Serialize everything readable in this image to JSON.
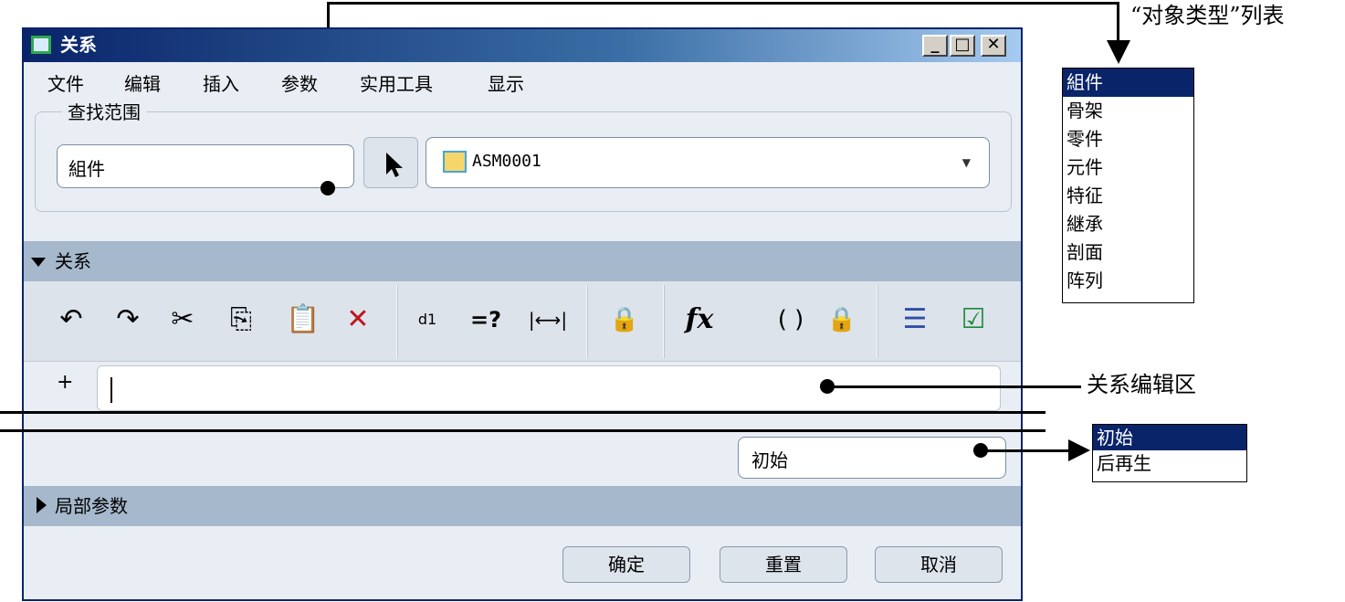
{
  "dialog": {
    "title": "关系",
    "window_buttons": {
      "minimize": "_",
      "maximize": "□",
      "close": "✕"
    }
  },
  "menu": [
    "文件",
    "编辑",
    "插入",
    "参数",
    "实用工具",
    "显示"
  ],
  "search": {
    "legend": "查找范围",
    "object_type": "組件",
    "model": "ASM0001"
  },
  "relations": {
    "header": "关系",
    "editor_plus": "+"
  },
  "toolbar": {
    "undo": "↶",
    "redo": "↷",
    "cut": "✂",
    "copy": "⎘",
    "paste": "📋",
    "delete": "✕",
    "units": "d1",
    "verify": "=?",
    "dimension": "|⟷|",
    "sort": "🔒",
    "function": "fx",
    "brackets": "( )",
    "evaluate": "🔒",
    "list": "☰",
    "check": "☑"
  },
  "timing": {
    "value": "初始"
  },
  "local_params": {
    "header": "局部参数"
  },
  "buttons": {
    "ok": "确定",
    "reset": "重置",
    "cancel": "取消"
  },
  "callouts": {
    "object_type_list": "“对象类型”列表",
    "editor_area": "关系编辑区"
  },
  "object_type_list": [
    "組件",
    "骨架",
    "零件",
    "元件",
    "特征",
    "継承",
    "剖面",
    "阵列"
  ],
  "timing_list": [
    "初始",
    "后再生"
  ],
  "colors": {
    "title_bar": "#0a246a",
    "section_bar": "#a6b8cc",
    "dialog_bg": "#e9eef4",
    "selection": "#0a246a"
  }
}
